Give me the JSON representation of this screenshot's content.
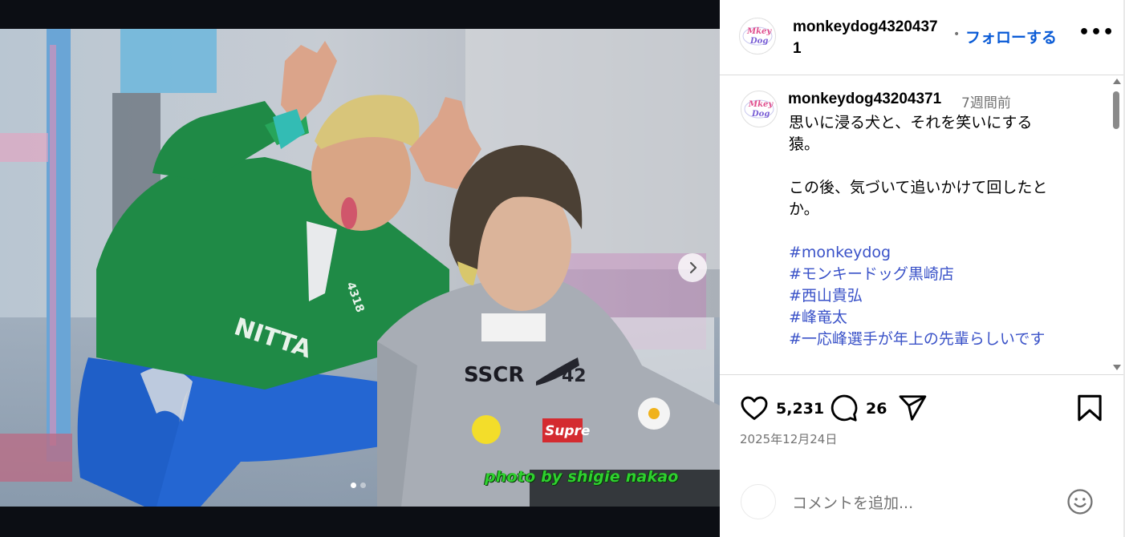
{
  "post": {
    "username": "monkeydog43204371",
    "follow_label": "フォローする",
    "header_separator": "•",
    "more_label": "•••",
    "caption": {
      "username": "monkeydog43204371",
      "time": "7週間前",
      "lines": [
        "思いに浸る犬と、それを笑いにする",
        "猿。",
        "",
        "この後、気づいて追いかけて回したと",
        "か。",
        ""
      ],
      "hashtags": [
        "#monkeydog",
        "#モンキードッグ黒崎店",
        "#西山貴弘",
        "#峰竜太",
        "#一応峰選手が年上の先輩らしいです"
      ]
    },
    "likes": "5,231",
    "comments": "26",
    "date": "2025年12月24日",
    "comment_placeholder": "コメントを追加...",
    "photo_credit": "photo by shigie nakao",
    "carousel": {
      "slide_count": 2,
      "active_index": 0
    },
    "icons": [
      "heart-icon",
      "comment-icon",
      "share-icon",
      "bookmark-icon",
      "emoji-icon",
      "chevron-right-icon"
    ]
  }
}
